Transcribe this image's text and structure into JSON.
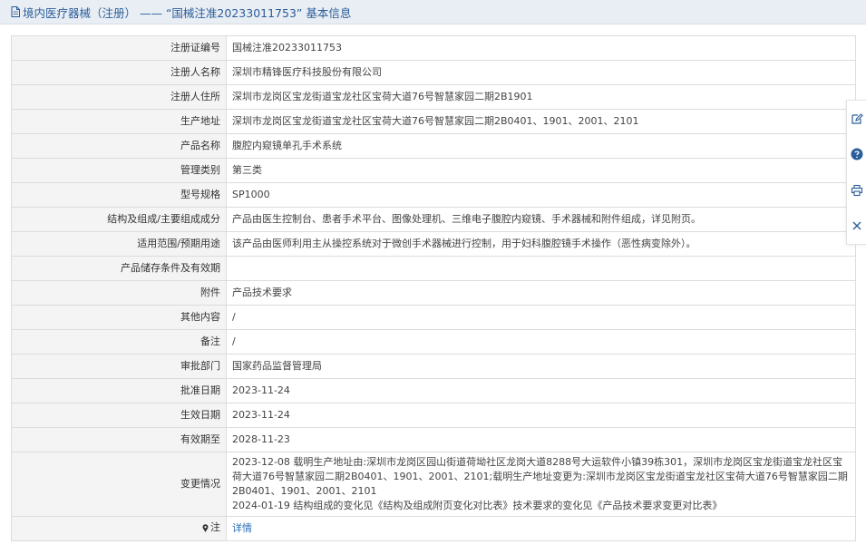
{
  "header": {
    "title": "境内医疗器械（注册） —— “国械注准20233011753” 基本信息"
  },
  "rows": [
    {
      "label": "注册证编号",
      "value": "国械注准20233011753"
    },
    {
      "label": "注册人名称",
      "value": "深圳市精锋医疗科技股份有限公司"
    },
    {
      "label": "注册人住所",
      "value": "深圳市龙岗区宝龙街道宝龙社区宝荷大道76号智慧家园二期2B1901"
    },
    {
      "label": "生产地址",
      "value": "深圳市龙岗区宝龙街道宝龙社区宝荷大道76号智慧家园二期2B0401、1901、2001、2101"
    },
    {
      "label": "产品名称",
      "value": "腹腔内窥镜单孔手术系统"
    },
    {
      "label": "管理类别",
      "value": "第三类"
    },
    {
      "label": "型号规格",
      "value": "SP1000"
    },
    {
      "label": "结构及组成/主要组成成分",
      "value": "产品由医生控制台、患者手术平台、图像处理机、三维电子腹腔内窥镜、手术器械和附件组成，详见附页。"
    },
    {
      "label": "适用范围/预期用途",
      "value": "该产品由医师利用主从操控系统对于微创手术器械进行控制，用于妇科腹腔镜手术操作（恶性病变除外）。"
    },
    {
      "label": "产品储存条件及有效期",
      "value": ""
    },
    {
      "label": "附件",
      "value": "产品技术要求"
    },
    {
      "label": "其他内容",
      "value": "/"
    },
    {
      "label": "备注",
      "value": "/"
    },
    {
      "label": "审批部门",
      "value": "国家药品监督管理局"
    },
    {
      "label": "批准日期",
      "value": "2023-11-24"
    },
    {
      "label": "生效日期",
      "value": "2023-11-24"
    },
    {
      "label": "有效期至",
      "value": "2028-11-23"
    }
  ],
  "change": {
    "label": "变更情况",
    "lines": [
      "2023-12-08 载明生产地址由:深圳市龙岗区园山街道荷坳社区龙岗大道8288号大运软件小镇39栋301，深圳市龙岗区宝龙街道宝龙社区宝荷大道76号智慧家园二期2B0401、1901、2001、2101;载明生产地址变更为:深圳市龙岗区宝龙街道宝龙社区宝荷大道76号智慧家园二期2B0401、1901、2001、2101",
      "2024-01-19 结构组成的变化见《结构及组成附页变化对比表》技术要求的变化见《产品技术要求变更对比表》"
    ]
  },
  "note": {
    "label": "注",
    "link": "详情"
  },
  "icons": {
    "header": "document-icon",
    "note": "pin-icon",
    "toolbar": [
      "edit-icon",
      "help-icon",
      "print-icon",
      "close-icon"
    ]
  },
  "colors": {
    "accent": "#2b5d9a",
    "link": "#2a6db5",
    "label_bg": "#f4f4f4",
    "header_bg": "#e9eef4"
  }
}
